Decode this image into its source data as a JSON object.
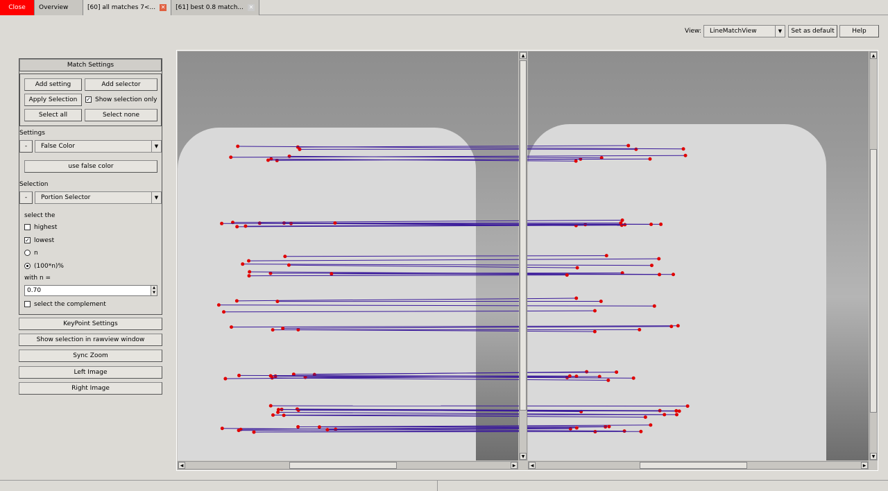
{
  "tabs": [
    {
      "label": "Close"
    },
    {
      "label": "Overview"
    },
    {
      "label": "[60] all matches 7<..."
    },
    {
      "label": "[61] best 0.8 match..."
    }
  ],
  "toolbar": {
    "view_label": "View:",
    "view_value": "LineMatchView",
    "set_default": "Set as default",
    "help": "Help"
  },
  "match_settings": {
    "title": "Match Settings",
    "add_setting": "Add setting",
    "add_selector": "Add selector",
    "apply_selection": "Apply Selection",
    "show_selection_only": "Show selection only",
    "show_selection_only_checked": true,
    "select_all": "Select all",
    "select_none": "Select none"
  },
  "settings": {
    "label": "Settings",
    "remove": "-",
    "value": "False Color",
    "use_false_color": "use false color"
  },
  "selection": {
    "label": "Selection",
    "remove": "-",
    "value": "Portion Selector",
    "select_the": "select the",
    "highest": "highest",
    "highest_checked": false,
    "lowest": "lowest",
    "lowest_checked": true,
    "n": "n",
    "percent": "(100*n)%",
    "selected_radio": "(100*n)%",
    "with_n": "with n =",
    "n_value": "0.70",
    "complement": "select the complement",
    "complement_checked": false
  },
  "buttons": {
    "keypoint": "KeyPoint Settings",
    "rawview": "Show selection in rawview window",
    "sync_zoom": "Sync Zoom",
    "left_image": "Left Image",
    "right_image": "Right Image"
  },
  "colors": {
    "close_tab": "#ff0000",
    "match_point": "#e00000",
    "match_line": "#3a1a9a"
  }
}
